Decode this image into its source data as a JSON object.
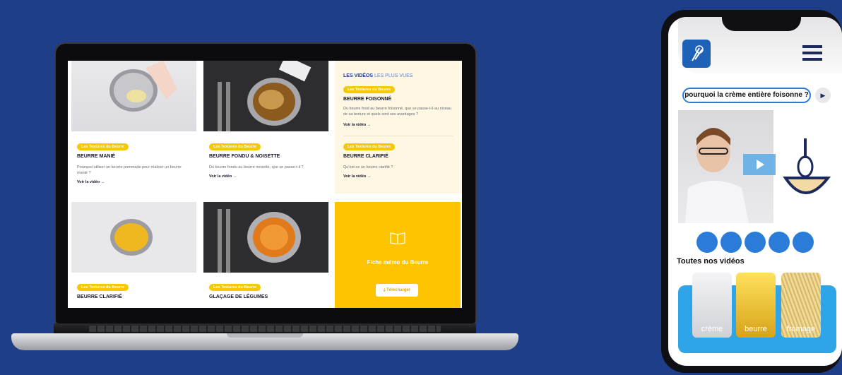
{
  "laptop": {
    "cards": [
      {
        "tag": "Les Textures du Beurre",
        "title": "BEURRE MANIÉ",
        "desc": "Pourquoi utiliser un beurre pommade pour réaliser un beurre manié ?",
        "link": "Voir la vidéo  →"
      },
      {
        "tag": "Les Textures du Beurre",
        "title": "BEURRE FONDU & NOISETTE",
        "desc": "Du beurre fondu au beurre noisette, que se passe-t-il ?",
        "link": "Voir la vidéo  →"
      },
      {
        "tag": "Les Textures du Beurre",
        "title": "BEURRE CLARIFIÉ"
      },
      {
        "tag": "Les Textures du Beurre",
        "title": "GLAÇAGE DE LÉGUMES"
      }
    ],
    "side": {
      "heading_bold": "LES VIDÉOS",
      "heading_light": "LES PLUS VUES",
      "items": [
        {
          "tag": "Les Textures du Beurre",
          "title": "BEURRE FOISONNÉ",
          "desc": "Du beurre froid au beurre foisonné, que se passe-t-il au niveau de sa texture et quels sont ses avantages ?",
          "link": "Voir la vidéo  →"
        },
        {
          "tag": "Les Textures du Beurre",
          "title": "BEURRE CLARIFIÉ",
          "desc": "Qu'est-ce un beurre clarifié ?",
          "link": "Voir la vidéo  →"
        }
      ]
    },
    "memo": {
      "title": "Fiche mémo du Beurre",
      "button": "⤓  Télécharger",
      "icon": "book-icon"
    }
  },
  "phone": {
    "question": "pourquoi la crème entière foisonne ?",
    "section_title": "Toutes nos vidéos",
    "categories": [
      "crème",
      "beurre",
      "fromage"
    ],
    "action_icons": [
      "thumbs-up-icon",
      "comment-icon",
      "share-icon",
      "heart-icon",
      "user-icon"
    ]
  },
  "colors": {
    "background": "#1e3f87",
    "accent_yellow": "#ffc400",
    "accent_blue": "#2b7bd9"
  }
}
